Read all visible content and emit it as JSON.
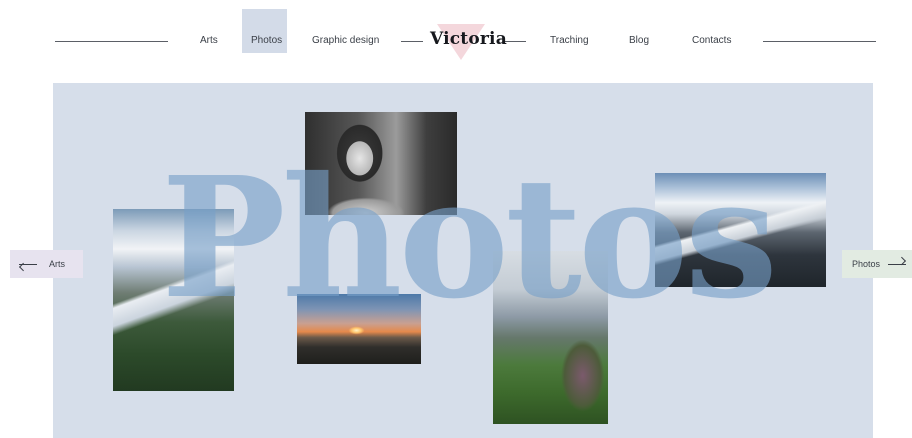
{
  "nav": {
    "items": [
      {
        "label": "Arts"
      },
      {
        "label": "Photos",
        "active": true
      },
      {
        "label": "Graphic design"
      },
      {
        "label": "Traching"
      },
      {
        "label": "Blog"
      },
      {
        "label": "Contacts"
      }
    ],
    "brand": "Victoria"
  },
  "hero": {
    "title": "Photos",
    "photos": [
      {
        "subject": "girl-portrait"
      },
      {
        "subject": "glacier"
      },
      {
        "subject": "snowy-mountains"
      },
      {
        "subject": "sunset"
      },
      {
        "subject": "mountain-flowers"
      }
    ]
  },
  "pager": {
    "prev_label": "Arts",
    "next_label": "Photos"
  },
  "colors": {
    "stage_bg": "#d6deea",
    "active_nav_bg": "#d3dbe8",
    "brand_accent": "#f4d7dc",
    "title_overlay": "#78a0c8",
    "prev_btn_bg": "#e7e3ef",
    "next_btn_bg": "#e2ebe2"
  }
}
